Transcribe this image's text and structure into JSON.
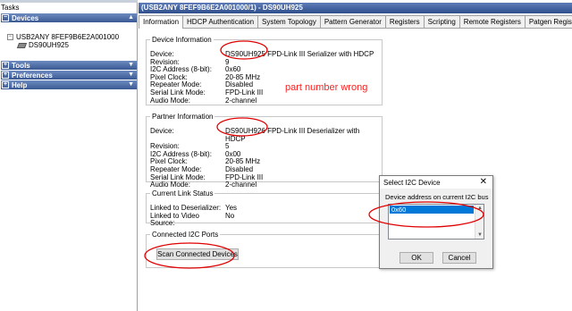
{
  "left_pane": {
    "title": "Tasks",
    "sections": {
      "devices": "Devices",
      "tools": "Tools",
      "preferences": "Preferences",
      "help": "Help"
    },
    "tree": {
      "root": "USB2ANY 8FEF9B6E2A001000",
      "child": "DS90UH925"
    }
  },
  "window": {
    "title": "(USB2ANY 8FEF9B6E2A001000/1) - DS90UH925"
  },
  "tabs": [
    "Information",
    "HDCP Authentication",
    "System Topology",
    "Pattern Generator",
    "Registers",
    "Scripting",
    "Remote Registers",
    "Patgen Registers"
  ],
  "device_info": {
    "legend": "Device Information",
    "rows": [
      {
        "k": "Device:",
        "v": "DS90UH925 FPD-Link III Serializer with HDCP"
      },
      {
        "k": "Revision:",
        "v": "9"
      },
      {
        "k": "I2C Address (8-bit):",
        "v": "0x60"
      },
      {
        "k": "Pixel Clock:",
        "v": "20-85 MHz"
      },
      {
        "k": "Repeater Mode:",
        "v": "Disabled"
      },
      {
        "k": "Serial Link Mode:",
        "v": "FPD-Link III"
      },
      {
        "k": "Audio Mode:",
        "v": "2-channel"
      }
    ]
  },
  "partner_info": {
    "legend": "Partner Information",
    "rows": [
      {
        "k": "Device:",
        "v": "DS90UH926 FPD-Link III Deserializer with HDCP"
      },
      {
        "k": "Revision:",
        "v": "5"
      },
      {
        "k": "I2C Address (8-bit):",
        "v": "0x00"
      },
      {
        "k": "Pixel Clock:",
        "v": "20-85 MHz"
      },
      {
        "k": "Repeater Mode:",
        "v": "Disabled"
      },
      {
        "k": "Serial Link Mode:",
        "v": "FPD-Link III"
      },
      {
        "k": "Audio Mode:",
        "v": "2-channel"
      }
    ]
  },
  "link_status": {
    "legend": "Current Link Status",
    "rows": [
      {
        "k": "Linked to Deserializer:",
        "v": "Yes"
      },
      {
        "k": "Linked to Video Source:",
        "v": "No"
      }
    ]
  },
  "i2c_ports": {
    "legend": "Connected I2C Ports",
    "scan_button": "Scan Connected Devices"
  },
  "dialog": {
    "title": "Select I2C Device",
    "close": "✕",
    "label": "Device address on current I2C bus",
    "items": [
      "0x60"
    ],
    "ok": "OK",
    "cancel": "Cancel"
  },
  "annotation": {
    "text": "part number wrong",
    "color": "#ff2020"
  },
  "colors": {
    "header_blue": "#3b5a94",
    "selection": "#0078d7"
  }
}
